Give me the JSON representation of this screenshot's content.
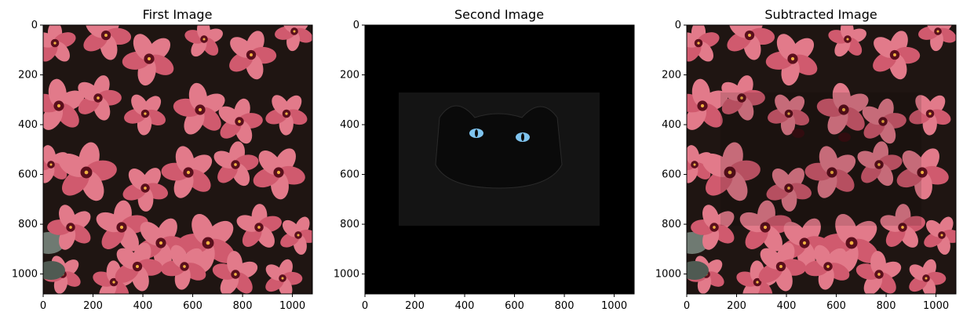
{
  "figure": {
    "panels": [
      {
        "title": "First Image",
        "image_desc": "pink-red oxalis flowers on dark foliage",
        "xticks": [
          "0",
          "200",
          "400",
          "600",
          "800",
          "1000"
        ],
        "yticks": [
          "0",
          "200",
          "400",
          "600",
          "800",
          "1000"
        ]
      },
      {
        "title": "Second Image",
        "image_desc": "black cat with blue eyes on black background",
        "xticks": [
          "0",
          "200",
          "400",
          "600",
          "800",
          "1000"
        ],
        "yticks": [
          "0",
          "200",
          "400",
          "600",
          "800",
          "1000"
        ]
      },
      {
        "title": "Subtracted Image",
        "image_desc": "flowers with faint cat-shaped subtraction artifact",
        "xticks": [
          "0",
          "200",
          "400",
          "600",
          "800",
          "1000"
        ],
        "yticks": [
          "0",
          "200",
          "400",
          "600",
          "800",
          "1000"
        ]
      }
    ],
    "axis": {
      "xlim": [
        0,
        1080
      ],
      "ylim": [
        1080,
        0
      ]
    },
    "colors": {
      "petal": "#d05a6e",
      "petal_light": "#e27a8a",
      "center": "#5a0f1c",
      "foliage": "#1f1512",
      "leaf": "#6f7a72",
      "cat_eye": "#7fc4ef"
    }
  }
}
